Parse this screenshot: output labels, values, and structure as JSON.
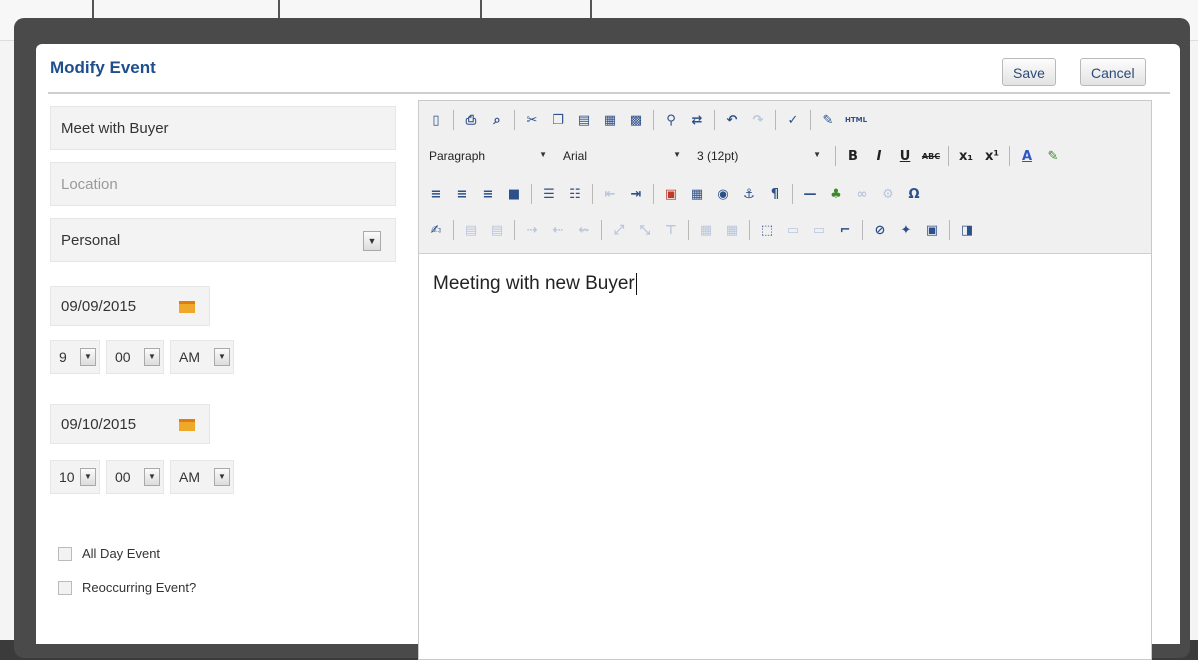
{
  "modal": {
    "title": "Modify Event",
    "save_label": "Save",
    "cancel_label": "Cancel"
  },
  "form": {
    "title_value": "Meet with Buyer",
    "location_placeholder": "Location",
    "category_value": "Personal",
    "start_date": "09/09/2015",
    "start_hour": "9",
    "start_minute": "00",
    "start_ampm": "AM",
    "end_date": "09/10/2015",
    "end_hour": "10",
    "end_minute": "00",
    "end_ampm": "AM",
    "all_day_label": "All Day Event",
    "reoccurring_label": "Reoccurring Event?"
  },
  "editor": {
    "format_value": "Paragraph",
    "font_value": "Arial",
    "size_value": "3 (12pt)",
    "content": "Meeting with new Buyer",
    "bold_glyph": "B",
    "italic_glyph": "I",
    "underline_glyph": "U",
    "strike_glyph": "ABC",
    "html_glyph": "HTML",
    "omega_glyph": "Ω"
  },
  "colors": {
    "title": "#1f4e8c",
    "icon": "#2d4f8a",
    "calendar": "#f0a82b"
  }
}
